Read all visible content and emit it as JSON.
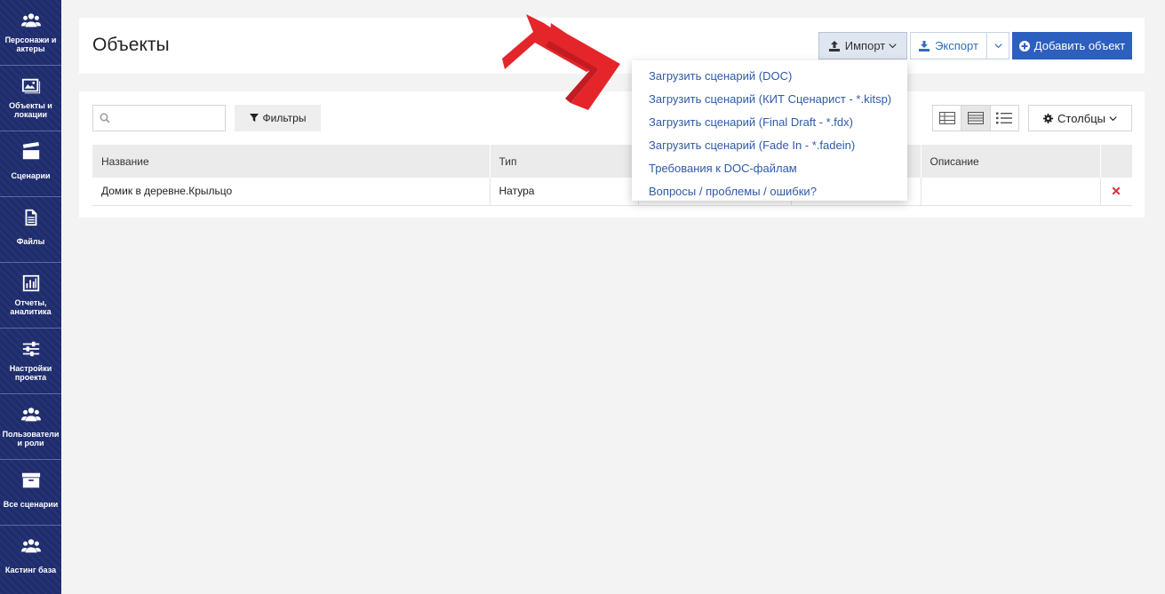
{
  "sidebar": {
    "items": [
      {
        "label": "Персонажи и актеры",
        "icon": "users-icon"
      },
      {
        "label": "Объекты и локации",
        "icon": "image-icon"
      },
      {
        "label": "Сценарии",
        "icon": "clapperboard-icon"
      },
      {
        "label": "Файлы",
        "icon": "file-icon"
      },
      {
        "label": "Отчеты, аналитика",
        "icon": "bar-chart-icon"
      },
      {
        "label": "Настройки проекта",
        "icon": "sliders-icon"
      },
      {
        "label": "Пользователи и роли",
        "icon": "users-icon"
      },
      {
        "label": "Все сценарии",
        "icon": "archive-icon"
      },
      {
        "label": "Кастинг база",
        "icon": "users-icon"
      }
    ]
  },
  "header": {
    "title": "Объекты",
    "import_label": "Импорт",
    "export_label": "Экспорт",
    "add_label": "Добавить объект"
  },
  "toolbar": {
    "search_placeholder": "",
    "filter_label": "Фильтры",
    "columns_label": "Столбцы"
  },
  "table": {
    "headers": [
      "Название",
      "Тип",
      "",
      "",
      "Описание",
      ""
    ],
    "rows": [
      {
        "name": "Домик в деревне.Крыльцо",
        "type": "Натура",
        "col3": "",
        "col4": "",
        "description": ""
      }
    ]
  },
  "import_menu": {
    "items": [
      "Загрузить сценарий (DOC)",
      "Загрузить сценарий (КИТ Сценарист - *.kitsp)",
      "Загрузить сценарий (Final Draft - *.fdx)",
      "Загрузить сценарий (Fade In - *.fadein)",
      "Требования к DOC-файлам",
      "Вопросы / проблемы / ошибки?"
    ]
  },
  "colors": {
    "sidebar": "#1f2d6e",
    "primary": "#2d5fbf",
    "link": "#2f5aa8",
    "delete": "#d9333c",
    "arrow": "#e4262b"
  }
}
